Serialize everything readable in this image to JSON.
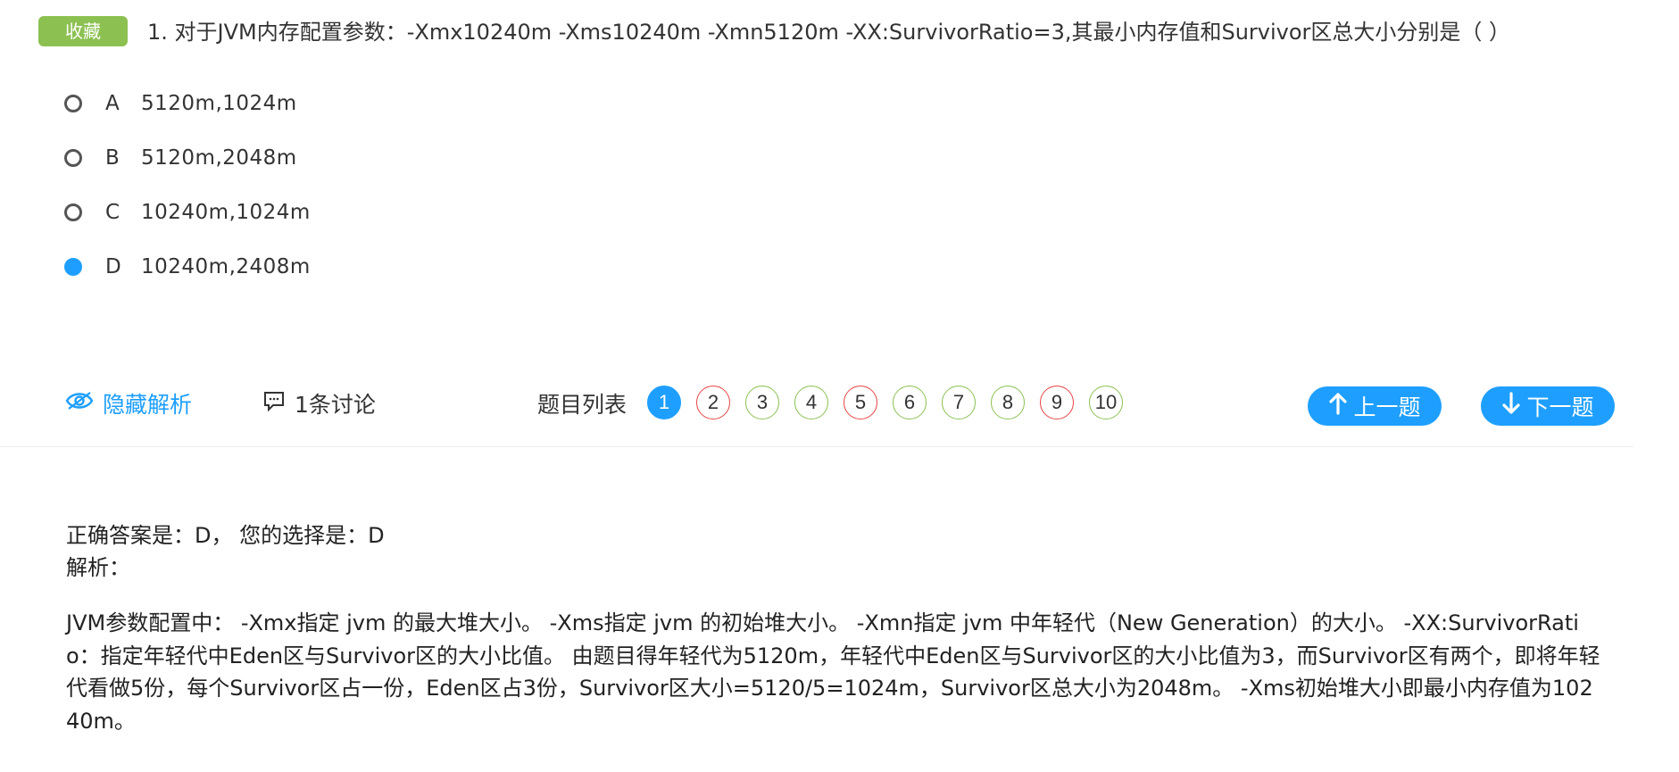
{
  "question": {
    "favorite_label": "收藏",
    "title": "1. 对于JVM内存配置参数：-Xmx10240m -Xms10240m -Xmn5120m -XX:SurvivorRatio=3,其最小内存值和Survivor区总大小分别是（ ）",
    "options": [
      {
        "letter": "A",
        "text": "5120m,1024m",
        "selected": false
      },
      {
        "letter": "B",
        "text": "5120m,2048m",
        "selected": false
      },
      {
        "letter": "C",
        "text": "10240m,1024m",
        "selected": false
      },
      {
        "letter": "D",
        "text": "10240m,2408m",
        "selected": true
      }
    ]
  },
  "toolbar": {
    "hide_analysis": "隐藏解析",
    "discussion": "1条讨论",
    "question_list_label": "题目列表",
    "question_numbers": [
      {
        "num": "1",
        "status": "current"
      },
      {
        "num": "2",
        "status": "wrong"
      },
      {
        "num": "3",
        "status": "correct"
      },
      {
        "num": "4",
        "status": "correct"
      },
      {
        "num": "5",
        "status": "wrong"
      },
      {
        "num": "6",
        "status": "correct"
      },
      {
        "num": "7",
        "status": "correct"
      },
      {
        "num": "8",
        "status": "correct"
      },
      {
        "num": "9",
        "status": "wrong"
      },
      {
        "num": "10",
        "status": "correct"
      }
    ],
    "prev_label": "上一题",
    "next_label": "下一题"
  },
  "analysis": {
    "answer_line": "正确答案是：D， 您的选择是：D",
    "label": "解析：",
    "text": "JVM参数配置中： -Xmx指定 jvm 的最大堆大小。 -Xms指定 jvm 的初始堆大小。 -Xmn指定 jvm 中年轻代（New Generation）的大小。 -XX:SurvivorRatio：指定年轻代中Eden区与Survivor区的大小比值。 由题目得年轻代为5120m，年轻代中Eden区与Survivor区的大小比值为3，而Survivor区有两个，即将年轻代看做5份，每个Survivor区占一份，Eden区占3份，Survivor区大小=5120/5=1024m，Survivor区总大小为2048m。 -Xms初始堆大小即最小内存值为10240m。"
  },
  "colors": {
    "accent_blue": "#1e9fff",
    "favorite_green": "#8cc152",
    "wrong_red": "#e84545"
  }
}
